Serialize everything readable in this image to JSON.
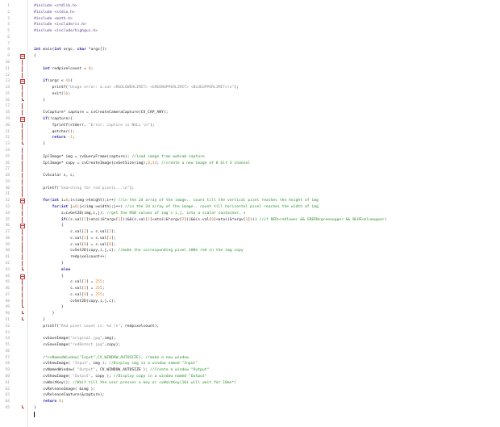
{
  "editor": {
    "lines": [
      [
        [
          "pp",
          "#include <stdlib.h>"
        ]
      ],
      [
        [
          "pp",
          "#include <stdio.h>"
        ]
      ],
      [
        [
          "pp",
          "#include <math.h>"
        ]
      ],
      [
        [
          "pp",
          "#include <include/cv.h>"
        ]
      ],
      [
        [
          "pp",
          "#include <include/highgui.h>"
        ]
      ],
      [],
      [],
      [
        [
          "kw",
          "int"
        ],
        [
          "op",
          " main("
        ],
        [
          "kw",
          "int"
        ],
        [
          "op",
          " argc, "
        ],
        [
          "kw",
          "char"
        ],
        [
          "op",
          " *argv[])"
        ]
      ],
      [
        [
          "op",
          "{"
        ]
      ],
      [],
      [
        [
          "op",
          "    "
        ],
        [
          "kw",
          "int"
        ],
        [
          "op",
          " redpixelcount = "
        ],
        [
          "num",
          "0"
        ],
        [
          "op",
          ";"
        ]
      ],
      [],
      [
        [
          "op",
          "    "
        ],
        [
          "kw",
          "if"
        ],
        [
          "op",
          "(argc < "
        ],
        [
          "num",
          "4"
        ],
        [
          "op",
          "){"
        ]
      ],
      [
        [
          "op",
          "        printf("
        ],
        [
          "str",
          "\"Usage error: a.out <REDLOWERLIMIT> <GREENUPPERLIMIT> <BLUEUPPERLIMIT>\\n\""
        ],
        [
          "op",
          ");"
        ]
      ],
      [
        [
          "op",
          "        exit("
        ],
        [
          "num",
          "1"
        ],
        [
          "op",
          ");"
        ]
      ],
      [
        [
          "op",
          "    }"
        ]
      ],
      [],
      [
        [
          "op",
          "    CvCapture* capture = cvCreateCameraCapture(CV_CAP_ANY);"
        ]
      ],
      [
        [
          "op",
          "    "
        ],
        [
          "kw",
          "if"
        ],
        [
          "op",
          "(!capture){"
        ]
      ],
      [
        [
          "op",
          "        fprintf(stderr, "
        ],
        [
          "str",
          "\"Error: capture is NULL \\n\""
        ],
        [
          "op",
          ");"
        ]
      ],
      [
        [
          "op",
          "        getchar();"
        ]
      ],
      [
        [
          "op",
          "        "
        ],
        [
          "kw",
          "return"
        ],
        [
          "op",
          " -"
        ],
        [
          "num",
          "1"
        ],
        [
          "op",
          ";"
        ]
      ],
      [
        [
          "op",
          "    }"
        ]
      ],
      [],
      [
        [
          "op",
          "    IplImage* img = cvQueryFrame(capture); "
        ],
        [
          "cm",
          "//load image from webcam capture"
        ]
      ],
      [
        [
          "op",
          "    IplImage* copy = cvCreateImage(cvGetSize(img),"
        ],
        [
          "num",
          "8"
        ],
        [
          "op",
          ","
        ],
        [
          "num",
          "3"
        ],
        [
          "op",
          "); "
        ],
        [
          "cm",
          "//create a new image of 8 bit 3 channel"
        ]
      ],
      [],
      [
        [
          "op",
          "    CvScalar s, c;"
        ]
      ],
      [],
      [
        [
          "op",
          "    printf("
        ],
        [
          "str",
          "\"Searching for red pixels...\\n\""
        ],
        [
          "op",
          ");"
        ]
      ],
      [],
      [
        [
          "op",
          "    "
        ],
        [
          "kw",
          "for"
        ],
        [
          "op",
          "("
        ],
        [
          "kw",
          "int"
        ],
        [
          "op",
          " i="
        ],
        [
          "num",
          "0"
        ],
        [
          "op",
          ";i<(img->height);i++) "
        ],
        [
          "cm",
          "//in the 2d array of the image.. count till the vertical pixel reaches the height of img"
        ]
      ],
      [
        [
          "op",
          "        "
        ],
        [
          "kw",
          "for"
        ],
        [
          "op",
          "("
        ],
        [
          "kw",
          "int"
        ],
        [
          "op",
          " j="
        ],
        [
          "num",
          "0"
        ],
        [
          "op",
          ";j<(img->width);j++) "
        ],
        [
          "cm",
          "//in the 2d array of the image.. count till horizontal pixel reaches the width of img"
        ]
      ],
      [
        [
          "op",
          "            s=cvGet2D(img,i,j); "
        ],
        [
          "cm",
          "//get the RGB values of img's i,j, into a scalar container, s"
        ]
      ],
      [
        [
          "op",
          "            "
        ],
        [
          "kw",
          "if"
        ],
        [
          "op",
          "((s.val["
        ],
        [
          "num",
          "2"
        ],
        [
          "op",
          "]>atoi(&*argv["
        ],
        [
          "num",
          "1"
        ],
        [
          "op",
          "]))&&(s.val["
        ],
        [
          "num",
          "1"
        ],
        [
          "op",
          "]<atoi(&*argv["
        ],
        [
          "num",
          "2"
        ],
        [
          "op",
          "]))&&(s.val["
        ],
        [
          "num",
          "0"
        ],
        [
          "op",
          "]<atoi(&*argv["
        ],
        [
          "num",
          "3"
        ],
        [
          "op",
          "]))) "
        ],
        [
          "cm",
          "//if RED>redlower && GREEN<greenupper && BLUE<blueupper)"
        ]
      ],
      [
        [
          "op",
          "            {"
        ]
      ],
      [
        [
          "op",
          "                c.val["
        ],
        [
          "num",
          "2"
        ],
        [
          "op",
          "] = s.val["
        ],
        [
          "num",
          "2"
        ],
        [
          "op",
          "];"
        ]
      ],
      [
        [
          "op",
          "                c.val["
        ],
        [
          "num",
          "1"
        ],
        [
          "op",
          "] = s.val["
        ],
        [
          "num",
          "1"
        ],
        [
          "op",
          "];"
        ]
      ],
      [
        [
          "op",
          "                c.val["
        ],
        [
          "num",
          "0"
        ],
        [
          "op",
          "] = s.val["
        ],
        [
          "num",
          "0"
        ],
        [
          "op",
          "];"
        ]
      ],
      [
        [
          "op",
          "                cvSet2D(copy,i,j,c); "
        ],
        [
          "cm",
          "//make the corresponding pixel 100% red in the img copy"
        ]
      ],
      [
        [
          "op",
          "                redpixelcount++;"
        ]
      ],
      [
        [
          "op",
          "            }"
        ]
      ],
      [
        [
          "op",
          "            "
        ],
        [
          "kw",
          "else"
        ]
      ],
      [
        [
          "op",
          "            {"
        ]
      ],
      [
        [
          "op",
          "                c.val["
        ],
        [
          "num",
          "2"
        ],
        [
          "op",
          "] = "
        ],
        [
          "num",
          "255"
        ],
        [
          "op",
          ";"
        ]
      ],
      [
        [
          "op",
          "                c.val["
        ],
        [
          "num",
          "1"
        ],
        [
          "op",
          "] = "
        ],
        [
          "num",
          "255"
        ],
        [
          "op",
          ";"
        ]
      ],
      [
        [
          "op",
          "                c.val["
        ],
        [
          "num",
          "0"
        ],
        [
          "op",
          "] = "
        ],
        [
          "num",
          "255"
        ],
        [
          "op",
          ";"
        ]
      ],
      [
        [
          "op",
          "                cvSet2D(copy,i,j,c);"
        ]
      ],
      [
        [
          "op",
          "            }"
        ]
      ],
      [
        [
          "op",
          "        }"
        ]
      ],
      [
        [
          "op",
          "    }"
        ]
      ],
      [
        [
          "op",
          "    printf("
        ],
        [
          "str",
          "\"Red pixel count is: %d \\n\""
        ],
        [
          "op",
          ", redpixelcount);"
        ]
      ],
      [],
      [
        [
          "op",
          "    cvSaveImage("
        ],
        [
          "str",
          "\"original.jpg\""
        ],
        [
          "op",
          ",img);"
        ]
      ],
      [
        [
          "op",
          "    cvSaveImage("
        ],
        [
          "str",
          "\"redDetect.jpg\""
        ],
        [
          "op",
          ",copy);"
        ]
      ],
      [],
      [
        [
          "op",
          "    "
        ],
        [
          "cm",
          "/*cvNamedWindow(\"Input\",CV_WINDOW_AUTOSIZE); //make a new window"
        ]
      ],
      [
        [
          "op",
          "    cvShowImage( "
        ],
        [
          "str",
          "\"Input\""
        ],
        [
          "op",
          ", img ); "
        ],
        [
          "cm",
          "//Display img in a window named \"Input\""
        ]
      ],
      [
        [
          "op",
          "    cvNamedWindow( "
        ],
        [
          "str",
          "\"Output\""
        ],
        [
          "op",
          ", CV_WINDOW_AUTOSIZE ); "
        ],
        [
          "cm",
          "//Create a window \"Output\""
        ]
      ],
      [
        [
          "op",
          "    cvShowImage( "
        ],
        [
          "str",
          "\"Output\""
        ],
        [
          "op",
          ", copy ); "
        ],
        [
          "cm",
          "//Display copy in a window named \"Output\""
        ]
      ],
      [
        [
          "op",
          "    cvWaitKey(); "
        ],
        [
          "cm",
          "//Wait till the user presses a key or cvWaitKey(10) will wait for 10ms*/"
        ]
      ],
      [
        [
          "op",
          "    cvReleaseImage( &img );"
        ]
      ],
      [
        [
          "op",
          "    cvReleaseCapture(&capture);"
        ]
      ],
      [
        [
          "op",
          "    "
        ],
        [
          "kw",
          "return"
        ],
        [
          "op",
          " "
        ],
        [
          "num",
          "0"
        ],
        [
          "op",
          ";"
        ]
      ],
      [
        [
          "op",
          "}"
        ]
      ]
    ]
  }
}
